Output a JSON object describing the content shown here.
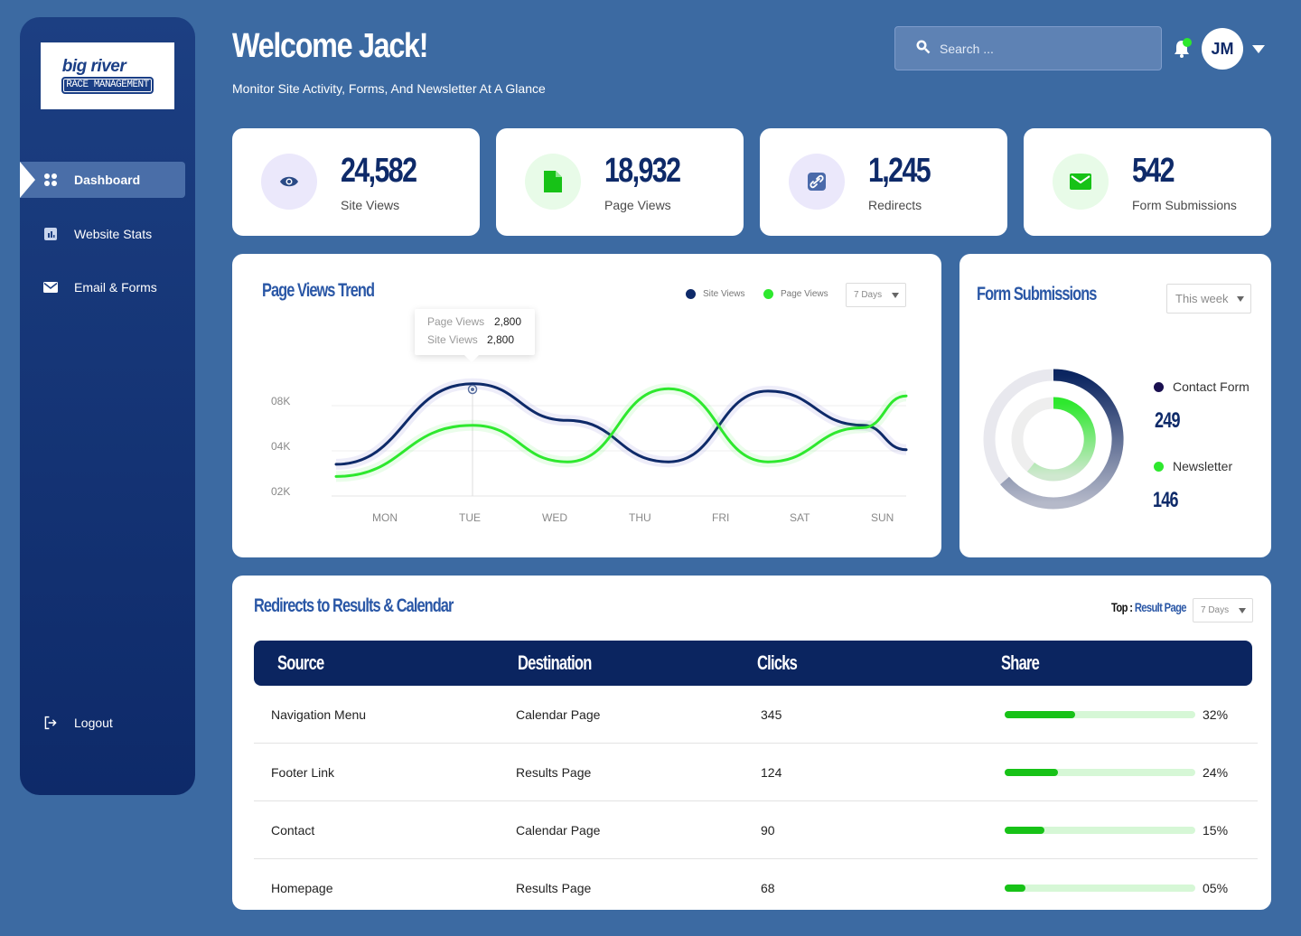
{
  "brand": {
    "logo_top": "big river",
    "logo_bottom": "RACE MANAGEMENT"
  },
  "sidebar": {
    "items": [
      {
        "label": "Dashboard",
        "icon": "grid-icon",
        "active": true
      },
      {
        "label": "Website Stats",
        "icon": "bar-chart-icon",
        "active": false
      },
      {
        "label": "Email & Forms",
        "icon": "mail-icon",
        "active": false
      }
    ],
    "logout_label": "Logout"
  },
  "header": {
    "welcome": "Welcome Jack!",
    "subtitle": "Monitor Site Activity, Forms, And Newsletter At A Glance",
    "search_placeholder": "Search ...",
    "avatar_initials": "JM"
  },
  "stats": [
    {
      "value": "24,582",
      "label": "Site Views",
      "icon": "eye-icon",
      "bg": "#ebe8fb",
      "fg": "#2a4a86"
    },
    {
      "value": "18,932",
      "label": "Page Views",
      "icon": "file-icon",
      "bg": "#e8fbe8",
      "fg": "#17c217"
    },
    {
      "value": "1,245",
      "label": "Redirects",
      "icon": "link-icon",
      "bg": "#ebe8fb",
      "fg": "#3c5b9a"
    },
    {
      "value": "542",
      "label": "Form Submissions",
      "icon": "mail-icon",
      "bg": "#e8fbe8",
      "fg": "#17c217"
    }
  ],
  "trend": {
    "title": "Page Views Trend",
    "legend": [
      "Site Views",
      "Page Views"
    ],
    "range": "7 Days",
    "tooltip": {
      "k1": "Page Views",
      "v1": "2,800",
      "k2": "Site Views",
      "v2": "2,800"
    },
    "y_ticks": [
      "08K",
      "04K",
      "02K"
    ],
    "x_ticks": [
      "MON",
      "TUE",
      "WED",
      "THU",
      "FRI",
      "SAT",
      "SUN"
    ]
  },
  "chart_data": {
    "type": "line",
    "title": "Page Views Trend",
    "x": [
      "MON",
      "TUE",
      "WED",
      "THU",
      "FRI",
      "SAT",
      "SUN"
    ],
    "series": [
      {
        "name": "Site Views",
        "color": "#0e2a69",
        "values": [
          2600,
          9200,
          6200,
          2800,
          8600,
          5800,
          3800
        ]
      },
      {
        "name": "Page Views",
        "color": "#2ee82e",
        "values": [
          1600,
          5800,
          2800,
          8800,
          2800,
          5600,
          8200
        ]
      }
    ]
  },
  "form_submissions": {
    "title": "Form Submissions",
    "range": "This week",
    "items": [
      {
        "name": "Contact Form",
        "value": "249",
        "color": "#1a1050"
      },
      {
        "name": "Newsletter",
        "value": "146",
        "color": "#2ee82e"
      }
    ]
  },
  "redirects": {
    "title": "Redirects to Results & Calendar",
    "top_prefix": "Top :",
    "top_value": "Result Page",
    "range": "7 Days",
    "columns": [
      "Source",
      "Destination",
      "Clicks",
      "Share"
    ],
    "rows": [
      {
        "source": "Navigation Menu",
        "destination": "Calendar Page",
        "clicks": "345",
        "share": "32%",
        "fraction": 0.37
      },
      {
        "source": "Footer Link",
        "destination": "Results Page",
        "clicks": "124",
        "share": "24%",
        "fraction": 0.28
      },
      {
        "source": "Contact",
        "destination": "Calendar Page",
        "clicks": "90",
        "share": "15%",
        "fraction": 0.21
      },
      {
        "source": "Homepage",
        "destination": "Results Page",
        "clicks": "68",
        "share": "05%",
        "fraction": 0.11
      }
    ]
  }
}
